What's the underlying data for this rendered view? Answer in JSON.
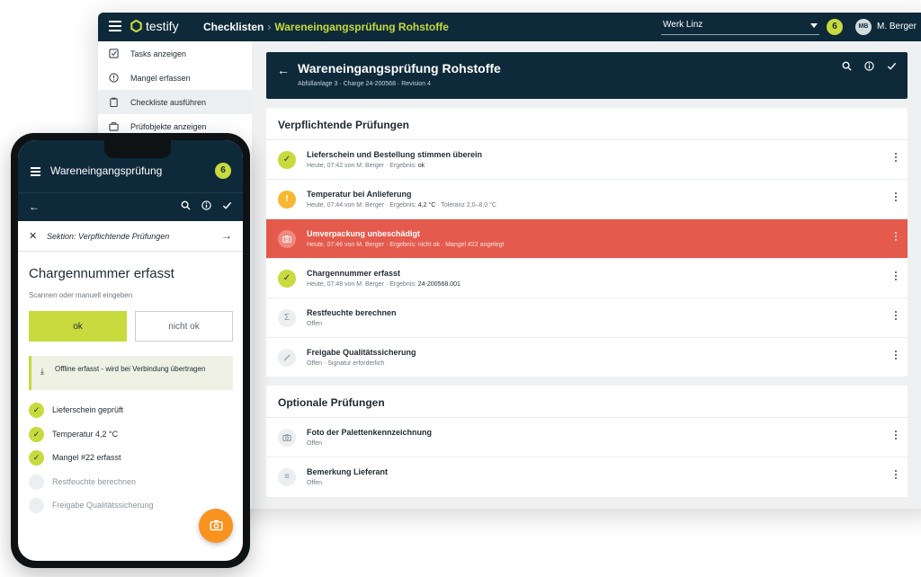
{
  "app": {
    "logo_text": "testify",
    "breadcrumb_root": "Checklisten",
    "breadcrumb_current": "Wareneingangsprüfung Rohstoffe",
    "werk": "Werk Linz",
    "notifications": "6",
    "user_initials": "MB",
    "user_name": "M. Berger"
  },
  "sidebar": {
    "items": [
      {
        "label": "Tasks anzeigen",
        "icon": "checkbox-icon"
      },
      {
        "label": "Mangel erfassen",
        "icon": "alert-circle-icon"
      },
      {
        "label": "Checkliste ausführen",
        "icon": "clipboard-icon",
        "active": true
      },
      {
        "label": "Prüfobjekte anzeigen",
        "icon": "case-icon"
      }
    ]
  },
  "header": {
    "title": "Wareneingangsprüfung Rohstoffe",
    "meta": "Abfüllanlage 3 · Charge 24-200568 · Revision 4"
  },
  "sections": [
    {
      "title": "Verpflichtende Prüfungen",
      "rows": [
        {
          "title": "Lieferschein und Bestellung stimmen überein",
          "meta": "Heute, 07:42 von M. Berger · Ergebnis:",
          "value": "ok",
          "status": "ok"
        },
        {
          "title": "Temperatur bei Anlieferung",
          "meta": "Heute, 07:44 von M. Berger · Ergebnis:",
          "value": "4,2 °C",
          "extra": "· Toleranz 2,0–8,0 °C",
          "status": "warn"
        },
        {
          "title": "Umverpackung unbeschädigt",
          "meta": "Heute, 07:46 von M. Berger · Ergebnis: nicht ok · Mangel #22 angelegt",
          "status": "error"
        },
        {
          "title": "Chargennummer erfasst",
          "meta": "Heute, 07:48 von M. Berger · Ergebnis:",
          "value": "24-200568.001",
          "status": "ok"
        },
        {
          "title": "Restfeuchte berechnen",
          "meta": "Offen",
          "status": "formula"
        },
        {
          "title": "Freigabe Qualitätssicherung",
          "meta": "Offen · Signatur erforderlich",
          "status": "signature"
        }
      ]
    },
    {
      "title": "Optionale Prüfungen",
      "rows": [
        {
          "title": "Foto der Palettenkennzeichnung",
          "meta": "Offen",
          "status": "camera"
        },
        {
          "title": "Bemerkung Lieferant",
          "meta": "Offen",
          "status": "text"
        }
      ]
    }
  ],
  "phone": {
    "title": "Wareneingangsprüfung",
    "notifications": "6",
    "section_label": "Sektion: Verpflichtende Prüfungen",
    "question": "Chargennummer erfasst",
    "hint": "Scannen oder manuell eingeben",
    "ok_label": "ok",
    "not_ok_label": "nicht ok",
    "offline_note": "Offline erfasst - wird bei Verbindung übertragen",
    "progress": [
      {
        "label": "Lieferschein geprüft",
        "done": true
      },
      {
        "label": "Temperatur 4,2 °C",
        "done": true
      },
      {
        "label": "Mangel #22 erfasst",
        "done": true
      },
      {
        "label": "Restfeuchte berechnen",
        "done": false
      },
      {
        "label": "Freigabe Qualitätssicherung",
        "done": false
      }
    ]
  },
  "colors": {
    "brand_dark": "#0e2a3a",
    "accent_lime": "#c7da3e",
    "warning": "#f7b733",
    "error": "#e45a4d",
    "fab": "#f7931e"
  }
}
